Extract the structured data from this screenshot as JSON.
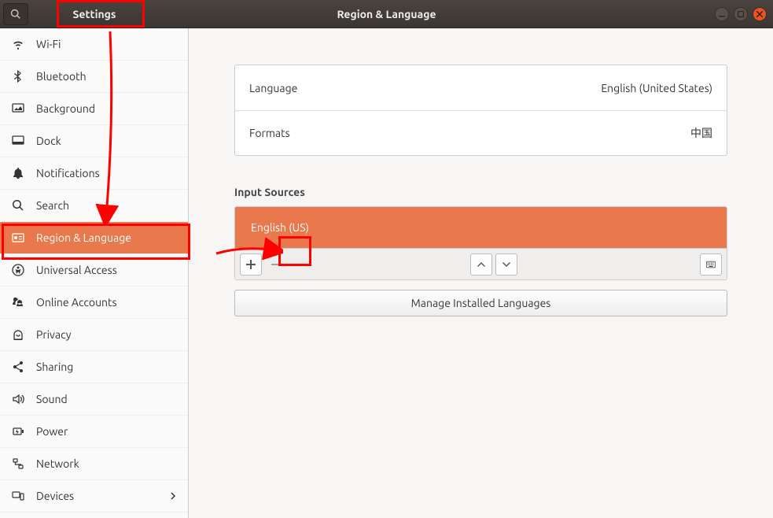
{
  "titlebar": {
    "app_title": "Settings",
    "page_title": "Region & Language"
  },
  "sidebar": {
    "items": [
      {
        "label": "Wi-Fi",
        "icon": "wifi"
      },
      {
        "label": "Bluetooth",
        "icon": "bluetooth"
      },
      {
        "label": "Background",
        "icon": "background"
      },
      {
        "label": "Dock",
        "icon": "dock"
      },
      {
        "label": "Notifications",
        "icon": "bell"
      },
      {
        "label": "Search",
        "icon": "search"
      },
      {
        "label": "Region & Language",
        "icon": "globe",
        "active": true
      },
      {
        "label": "Universal Access",
        "icon": "accessibility"
      },
      {
        "label": "Online Accounts",
        "icon": "accounts"
      },
      {
        "label": "Privacy",
        "icon": "privacy"
      },
      {
        "label": "Sharing",
        "icon": "share"
      },
      {
        "label": "Sound",
        "icon": "sound"
      },
      {
        "label": "Power",
        "icon": "power"
      },
      {
        "label": "Network",
        "icon": "network"
      },
      {
        "label": "Devices",
        "icon": "devices",
        "chevron": true
      }
    ]
  },
  "content": {
    "language_label": "Language",
    "language_value": "English (United States)",
    "formats_label": "Formats",
    "formats_value": "中国",
    "input_sources_label": "Input Sources",
    "input_sources": [
      "English (US)"
    ],
    "manage_button_label": "Manage Installed Languages"
  },
  "accent_color": "#e9794c"
}
